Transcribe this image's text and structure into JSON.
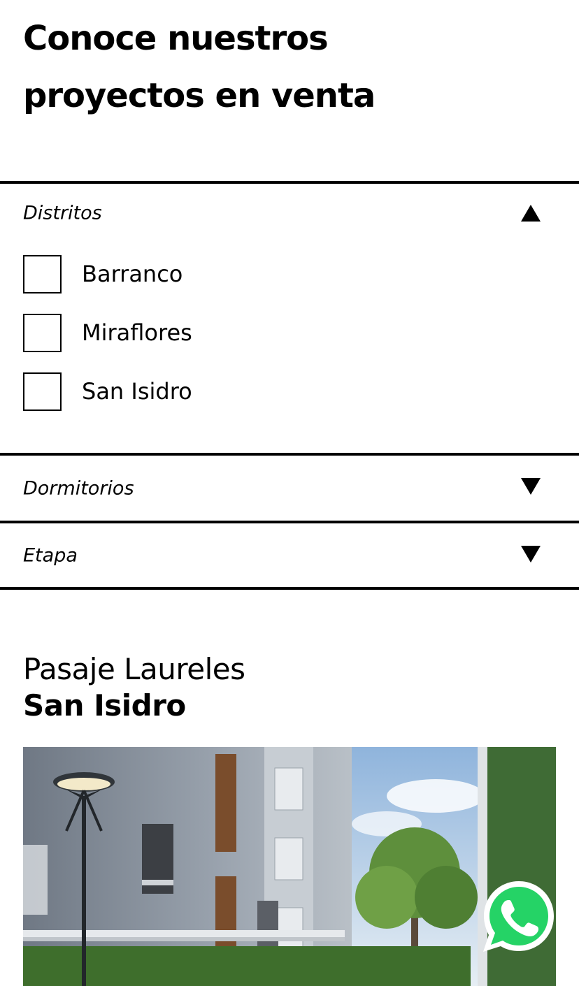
{
  "page": {
    "title": "Conoce nuestros proyectos en venta"
  },
  "filters": {
    "districts": {
      "label": "Distritos",
      "expanded": true,
      "options": [
        {
          "label": "Barranco",
          "checked": false
        },
        {
          "label": "Miraflores",
          "checked": false
        },
        {
          "label": "San Isidro",
          "checked": false
        }
      ]
    },
    "bedrooms": {
      "label": "Dormitorios",
      "expanded": false
    },
    "stage": {
      "label": "Etapa",
      "expanded": false
    }
  },
  "project": {
    "name": "Pasaje Laureles",
    "district": "San Isidro"
  },
  "colors": {
    "text": "#000000",
    "background": "#ffffff",
    "whatsapp": "#25d366"
  },
  "icons": {
    "expanded": "triangle-up-icon",
    "collapsed": "triangle-down-icon",
    "chat": "whatsapp-icon"
  }
}
